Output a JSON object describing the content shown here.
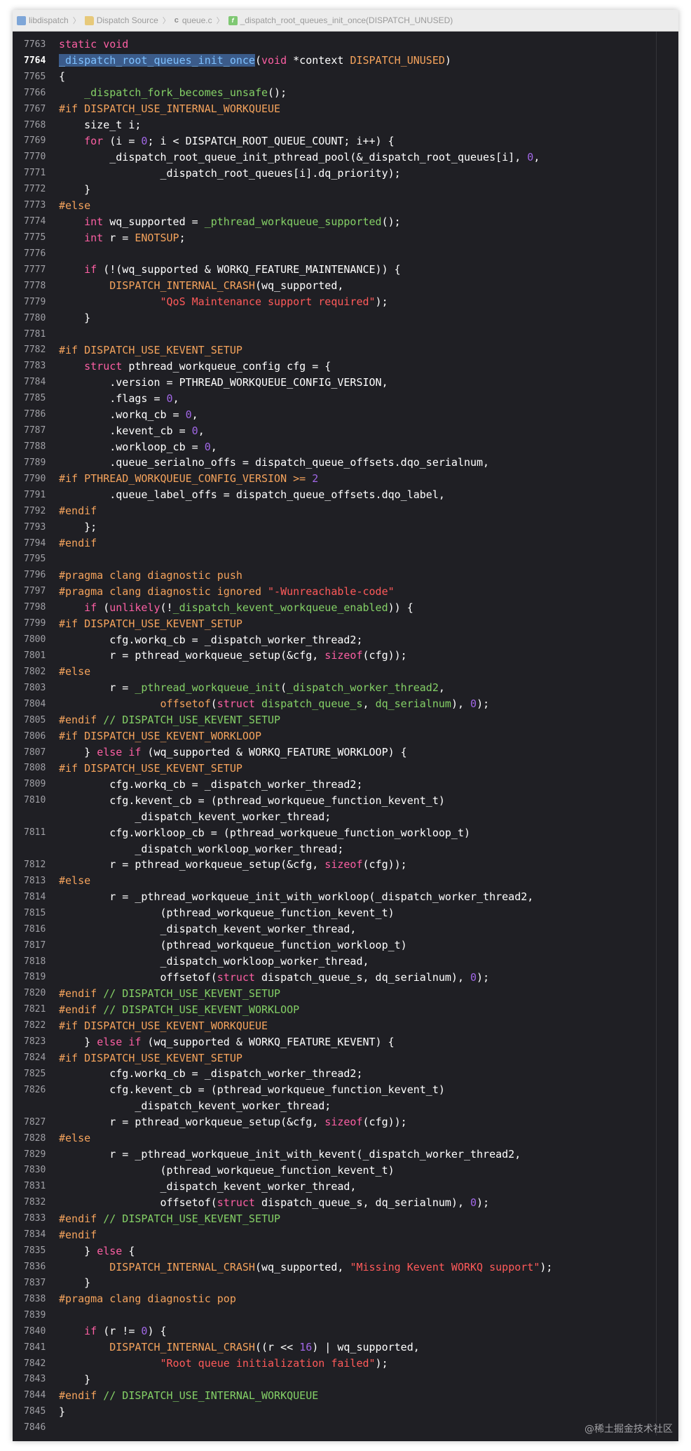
{
  "jumpbar": {
    "crumbs": [
      {
        "icon": "project-icon",
        "label": "libdispatch"
      },
      {
        "icon": "folder-icon",
        "label": "Dispatch Source"
      },
      {
        "icon": "c-file-icon",
        "label": "queue.c"
      },
      {
        "icon": "function-icon",
        "label": "_dispatch_root_queues_init_once(DISPATCH_UNUSED)"
      }
    ]
  },
  "watermark": "@稀土掘金技术社区",
  "current_line": "7764",
  "lines": [
    {
      "n": "7763",
      "s": [
        [
          "kw",
          "static void"
        ]
      ]
    },
    {
      "n": "7764",
      "s": [
        [
          "sel",
          "_dispatch_root_queues_init_once"
        ],
        [
          "pl",
          "("
        ],
        [
          "kw",
          "void"
        ],
        [
          "pl",
          " *context "
        ],
        [
          "pp",
          "DISPATCH_UNUSED"
        ],
        [
          "pl",
          ")"
        ]
      ]
    },
    {
      "n": "7765",
      "s": [
        [
          "pl",
          "{"
        ]
      ]
    },
    {
      "n": "7766",
      "s": [
        [
          "pl",
          "    "
        ],
        [
          "grn",
          "_dispatch_fork_becomes_unsafe"
        ],
        [
          "pl",
          "();"
        ]
      ]
    },
    {
      "n": "7767",
      "s": [
        [
          "pp",
          "#if DISPATCH_USE_INTERNAL_WORKQUEUE"
        ]
      ]
    },
    {
      "n": "7768",
      "s": [
        [
          "pl",
          "    size_t i;"
        ]
      ]
    },
    {
      "n": "7769",
      "s": [
        [
          "pl",
          "    "
        ],
        [
          "kw",
          "for"
        ],
        [
          "pl",
          " (i = "
        ],
        [
          "num",
          "0"
        ],
        [
          "pl",
          "; i < DISPATCH_ROOT_QUEUE_COUNT; i++) {"
        ]
      ]
    },
    {
      "n": "7770",
      "s": [
        [
          "pl",
          "        _dispatch_root_queue_init_pthread_pool(&_dispatch_root_queues[i], "
        ],
        [
          "num",
          "0"
        ],
        [
          "pl",
          ","
        ]
      ]
    },
    {
      "n": "7771",
      "s": [
        [
          "pl",
          "                _dispatch_root_queues[i].dq_priority);"
        ]
      ]
    },
    {
      "n": "7772",
      "s": [
        [
          "pl",
          "    }"
        ]
      ]
    },
    {
      "n": "7773",
      "s": [
        [
          "pp",
          "#else"
        ]
      ]
    },
    {
      "n": "7774",
      "s": [
        [
          "pl",
          "    "
        ],
        [
          "kw",
          "int"
        ],
        [
          "pl",
          " wq_supported = "
        ],
        [
          "grn",
          "_pthread_workqueue_supported"
        ],
        [
          "pl",
          "();"
        ]
      ]
    },
    {
      "n": "7775",
      "s": [
        [
          "pl",
          "    "
        ],
        [
          "kw",
          "int"
        ],
        [
          "pl",
          " r = "
        ],
        [
          "pp",
          "ENOTSUP"
        ],
        [
          "pl",
          ";"
        ]
      ]
    },
    {
      "n": "7776",
      "s": []
    },
    {
      "n": "7777",
      "s": [
        [
          "pl",
          "    "
        ],
        [
          "kw",
          "if"
        ],
        [
          "pl",
          " (!(wq_supported & WORKQ_FEATURE_MAINTENANCE)) {"
        ]
      ]
    },
    {
      "n": "7778",
      "s": [
        [
          "pl",
          "        "
        ],
        [
          "pp",
          "DISPATCH_INTERNAL_CRASH"
        ],
        [
          "pl",
          "(wq_supported,"
        ]
      ]
    },
    {
      "n": "7779",
      "s": [
        [
          "pl",
          "                "
        ],
        [
          "str",
          "\"QoS Maintenance support required\""
        ],
        [
          "pl",
          ");"
        ]
      ]
    },
    {
      "n": "7780",
      "s": [
        [
          "pl",
          "    }"
        ]
      ]
    },
    {
      "n": "7781",
      "s": []
    },
    {
      "n": "7782",
      "s": [
        [
          "pp",
          "#if DISPATCH_USE_KEVENT_SETUP"
        ]
      ]
    },
    {
      "n": "7783",
      "s": [
        [
          "pl",
          "    "
        ],
        [
          "kw",
          "struct"
        ],
        [
          "pl",
          " pthread_workqueue_config cfg = {"
        ]
      ]
    },
    {
      "n": "7784",
      "s": [
        [
          "pl",
          "        .version = PTHREAD_WORKQUEUE_CONFIG_VERSION,"
        ]
      ]
    },
    {
      "n": "7785",
      "s": [
        [
          "pl",
          "        .flags = "
        ],
        [
          "num",
          "0"
        ],
        [
          "pl",
          ","
        ]
      ]
    },
    {
      "n": "7786",
      "s": [
        [
          "pl",
          "        .workq_cb = "
        ],
        [
          "num",
          "0"
        ],
        [
          "pl",
          ","
        ]
      ]
    },
    {
      "n": "7787",
      "s": [
        [
          "pl",
          "        .kevent_cb = "
        ],
        [
          "num",
          "0"
        ],
        [
          "pl",
          ","
        ]
      ]
    },
    {
      "n": "7788",
      "s": [
        [
          "pl",
          "        .workloop_cb = "
        ],
        [
          "num",
          "0"
        ],
        [
          "pl",
          ","
        ]
      ]
    },
    {
      "n": "7789",
      "s": [
        [
          "pl",
          "        .queue_serialno_offs = dispatch_queue_offsets.dqo_serialnum,"
        ]
      ]
    },
    {
      "n": "7790",
      "s": [
        [
          "pp",
          "#if PTHREAD_WORKQUEUE_CONFIG_VERSION >= "
        ],
        [
          "num",
          "2"
        ]
      ]
    },
    {
      "n": "7791",
      "s": [
        [
          "pl",
          "        .queue_label_offs = dispatch_queue_offsets.dqo_label,"
        ]
      ]
    },
    {
      "n": "7792",
      "s": [
        [
          "pp",
          "#endif"
        ]
      ]
    },
    {
      "n": "7793",
      "s": [
        [
          "pl",
          "    };"
        ]
      ]
    },
    {
      "n": "7794",
      "s": [
        [
          "pp",
          "#endif"
        ]
      ]
    },
    {
      "n": "7795",
      "s": []
    },
    {
      "n": "7796",
      "s": [
        [
          "pp",
          "#pragma clang diagnostic push"
        ]
      ]
    },
    {
      "n": "7797",
      "s": [
        [
          "pp",
          "#pragma clang diagnostic ignored "
        ],
        [
          "str",
          "\"-Wunreachable-code\""
        ]
      ]
    },
    {
      "n": "7798",
      "s": [
        [
          "pl",
          "    "
        ],
        [
          "kw",
          "if"
        ],
        [
          "pl",
          " ("
        ],
        [
          "kw",
          "unlikely"
        ],
        [
          "pl",
          "(!"
        ],
        [
          "grn",
          "_dispatch_kevent_workqueue_enabled"
        ],
        [
          "pl",
          ")) {"
        ]
      ]
    },
    {
      "n": "7799",
      "s": [
        [
          "pp",
          "#if DISPATCH_USE_KEVENT_SETUP"
        ]
      ]
    },
    {
      "n": "7800",
      "s": [
        [
          "pl",
          "        cfg.workq_cb = _dispatch_worker_thread2;"
        ]
      ]
    },
    {
      "n": "7801",
      "s": [
        [
          "pl",
          "        r = pthread_workqueue_setup(&cfg, "
        ],
        [
          "kw",
          "sizeof"
        ],
        [
          "pl",
          "(cfg));"
        ]
      ]
    },
    {
      "n": "7802",
      "s": [
        [
          "pp",
          "#else"
        ]
      ]
    },
    {
      "n": "7803",
      "s": [
        [
          "pl",
          "        r = "
        ],
        [
          "grn",
          "_pthread_workqueue_init"
        ],
        [
          "pl",
          "("
        ],
        [
          "grn",
          "_dispatch_worker_thread2"
        ],
        [
          "pl",
          ","
        ]
      ]
    },
    {
      "n": "7804",
      "s": [
        [
          "pl",
          "                "
        ],
        [
          "pp",
          "offsetof"
        ],
        [
          "pl",
          "("
        ],
        [
          "kw",
          "struct"
        ],
        [
          "pl",
          " "
        ],
        [
          "grn",
          "dispatch_queue_s"
        ],
        [
          "pl",
          ", "
        ],
        [
          "grn",
          "dq_serialnum"
        ],
        [
          "pl",
          "), "
        ],
        [
          "num",
          "0"
        ],
        [
          "pl",
          ");"
        ]
      ]
    },
    {
      "n": "7805",
      "s": [
        [
          "pp",
          "#endif "
        ],
        [
          "grn",
          "// DISPATCH_USE_KEVENT_SETUP"
        ]
      ]
    },
    {
      "n": "7806",
      "s": [
        [
          "pp",
          "#if DISPATCH_USE_KEVENT_WORKLOOP"
        ]
      ]
    },
    {
      "n": "7807",
      "s": [
        [
          "pl",
          "    } "
        ],
        [
          "kw",
          "else if"
        ],
        [
          "pl",
          " (wq_supported & WORKQ_FEATURE_WORKLOOP) {"
        ]
      ]
    },
    {
      "n": "7808",
      "s": [
        [
          "pp",
          "#if DISPATCH_USE_KEVENT_SETUP"
        ]
      ]
    },
    {
      "n": "7809",
      "s": [
        [
          "pl",
          "        cfg.workq_cb = _dispatch_worker_thread2;"
        ]
      ]
    },
    {
      "n": "7810",
      "s": [
        [
          "pl",
          "        cfg.kevent_cb = (pthread_workqueue_function_kevent_t)"
        ]
      ]
    },
    {
      "n": "",
      "s": [
        [
          "pl",
          "            _dispatch_kevent_worker_thread;"
        ]
      ]
    },
    {
      "n": "7811",
      "s": [
        [
          "pl",
          "        cfg.workloop_cb = (pthread_workqueue_function_workloop_t)"
        ]
      ]
    },
    {
      "n": "",
      "s": [
        [
          "pl",
          "            _dispatch_workloop_worker_thread;"
        ]
      ]
    },
    {
      "n": "7812",
      "s": [
        [
          "pl",
          "        r = pthread_workqueue_setup(&cfg, "
        ],
        [
          "kw",
          "sizeof"
        ],
        [
          "pl",
          "(cfg));"
        ]
      ]
    },
    {
      "n": "7813",
      "s": [
        [
          "pp",
          "#else"
        ]
      ]
    },
    {
      "n": "7814",
      "s": [
        [
          "pl",
          "        r = _pthread_workqueue_init_with_workloop(_dispatch_worker_thread2,"
        ]
      ]
    },
    {
      "n": "7815",
      "s": [
        [
          "pl",
          "                (pthread_workqueue_function_kevent_t)"
        ]
      ]
    },
    {
      "n": "7816",
      "s": [
        [
          "pl",
          "                _dispatch_kevent_worker_thread,"
        ]
      ]
    },
    {
      "n": "7817",
      "s": [
        [
          "pl",
          "                (pthread_workqueue_function_workloop_t)"
        ]
      ]
    },
    {
      "n": "7818",
      "s": [
        [
          "pl",
          "                _dispatch_workloop_worker_thread,"
        ]
      ]
    },
    {
      "n": "7819",
      "s": [
        [
          "pl",
          "                offsetof("
        ],
        [
          "kw",
          "struct"
        ],
        [
          "pl",
          " dispatch_queue_s, dq_serialnum), "
        ],
        [
          "num",
          "0"
        ],
        [
          "pl",
          ");"
        ]
      ]
    },
    {
      "n": "7820",
      "s": [
        [
          "pp",
          "#endif "
        ],
        [
          "grn",
          "// DISPATCH_USE_KEVENT_SETUP"
        ]
      ]
    },
    {
      "n": "7821",
      "s": [
        [
          "pp",
          "#endif "
        ],
        [
          "grn",
          "// DISPATCH_USE_KEVENT_WORKLOOP"
        ]
      ]
    },
    {
      "n": "7822",
      "s": [
        [
          "pp",
          "#if DISPATCH_USE_KEVENT_WORKQUEUE"
        ]
      ]
    },
    {
      "n": "7823",
      "s": [
        [
          "pl",
          "    } "
        ],
        [
          "kw",
          "else if"
        ],
        [
          "pl",
          " (wq_supported & WORKQ_FEATURE_KEVENT) {"
        ]
      ]
    },
    {
      "n": "7824",
      "s": [
        [
          "pp",
          "#if DISPATCH_USE_KEVENT_SETUP"
        ]
      ]
    },
    {
      "n": "7825",
      "s": [
        [
          "pl",
          "        cfg.workq_cb = _dispatch_worker_thread2;"
        ]
      ]
    },
    {
      "n": "7826",
      "s": [
        [
          "pl",
          "        cfg.kevent_cb = (pthread_workqueue_function_kevent_t)"
        ]
      ]
    },
    {
      "n": "",
      "s": [
        [
          "pl",
          "            _dispatch_kevent_worker_thread;"
        ]
      ]
    },
    {
      "n": "7827",
      "s": [
        [
          "pl",
          "        r = pthread_workqueue_setup(&cfg, "
        ],
        [
          "kw",
          "sizeof"
        ],
        [
          "pl",
          "(cfg));"
        ]
      ]
    },
    {
      "n": "7828",
      "s": [
        [
          "pp",
          "#else"
        ]
      ]
    },
    {
      "n": "7829",
      "s": [
        [
          "pl",
          "        r = _pthread_workqueue_init_with_kevent(_dispatch_worker_thread2,"
        ]
      ]
    },
    {
      "n": "7830",
      "s": [
        [
          "pl",
          "                (pthread_workqueue_function_kevent_t)"
        ]
      ]
    },
    {
      "n": "7831",
      "s": [
        [
          "pl",
          "                _dispatch_kevent_worker_thread,"
        ]
      ]
    },
    {
      "n": "7832",
      "s": [
        [
          "pl",
          "                offsetof("
        ],
        [
          "kw",
          "struct"
        ],
        [
          "pl",
          " dispatch_queue_s, dq_serialnum), "
        ],
        [
          "num",
          "0"
        ],
        [
          "pl",
          ");"
        ]
      ]
    },
    {
      "n": "7833",
      "s": [
        [
          "pp",
          "#endif "
        ],
        [
          "grn",
          "// DISPATCH_USE_KEVENT_SETUP"
        ]
      ]
    },
    {
      "n": "7834",
      "s": [
        [
          "pp",
          "#endif"
        ]
      ]
    },
    {
      "n": "7835",
      "s": [
        [
          "pl",
          "    } "
        ],
        [
          "kw",
          "else"
        ],
        [
          "pl",
          " {"
        ]
      ]
    },
    {
      "n": "7836",
      "s": [
        [
          "pl",
          "        "
        ],
        [
          "pp",
          "DISPATCH_INTERNAL_CRASH"
        ],
        [
          "pl",
          "(wq_supported, "
        ],
        [
          "str",
          "\"Missing Kevent WORKQ support\""
        ],
        [
          "pl",
          ");"
        ]
      ]
    },
    {
      "n": "7837",
      "s": [
        [
          "pl",
          "    }"
        ]
      ]
    },
    {
      "n": "7838",
      "s": [
        [
          "pp",
          "#pragma clang diagnostic pop"
        ]
      ]
    },
    {
      "n": "7839",
      "s": []
    },
    {
      "n": "7840",
      "s": [
        [
          "pl",
          "    "
        ],
        [
          "kw",
          "if"
        ],
        [
          "pl",
          " (r != "
        ],
        [
          "num",
          "0"
        ],
        [
          "pl",
          ") {"
        ]
      ]
    },
    {
      "n": "7841",
      "s": [
        [
          "pl",
          "        "
        ],
        [
          "pp",
          "DISPATCH_INTERNAL_CRASH"
        ],
        [
          "pl",
          "((r << "
        ],
        [
          "num",
          "16"
        ],
        [
          "pl",
          ") | wq_supported,"
        ]
      ]
    },
    {
      "n": "7842",
      "s": [
        [
          "pl",
          "                "
        ],
        [
          "str",
          "\"Root queue initialization failed\""
        ],
        [
          "pl",
          ");"
        ]
      ]
    },
    {
      "n": "7843",
      "s": [
        [
          "pl",
          "    }"
        ]
      ]
    },
    {
      "n": "7844",
      "s": [
        [
          "pp",
          "#endif "
        ],
        [
          "grn",
          "// DISPATCH_USE_INTERNAL_WORKQUEUE"
        ]
      ]
    },
    {
      "n": "7845",
      "s": [
        [
          "pl",
          "}"
        ]
      ]
    },
    {
      "n": "7846",
      "s": []
    }
  ]
}
